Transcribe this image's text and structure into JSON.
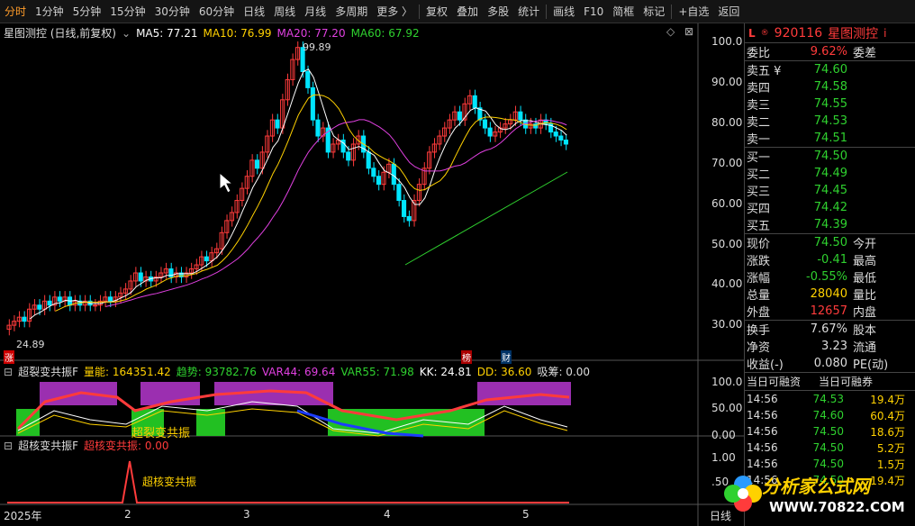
{
  "toolbar": {
    "items": [
      "分时",
      "1分钟",
      "5分钟",
      "15分钟",
      "30分钟",
      "60分钟",
      "日线",
      "周线",
      "月线",
      "多周期",
      "更多 〉",
      "复权",
      "叠加",
      "多股",
      "统计",
      "画线",
      "F10",
      "简框",
      "标记",
      "+自选",
      "返回"
    ]
  },
  "stock": {
    "marker": "L",
    "code": "920116",
    "name": "星图测控",
    "info": "i"
  },
  "main_pane": {
    "title": "星图测控 (日线,前复权)",
    "ma5": "MA5: 77.21",
    "ma10": "MA10: 76.99",
    "ma20": "MA20: 77.20",
    "ma60": "MA60: 67.92",
    "high_label": "99.89",
    "low_label": "24.89",
    "bang_label": "榜",
    "cai_label": "财",
    "zhang_label": "涨",
    "y_ticks": [
      "100.0",
      "90.00",
      "80.00",
      "70.00",
      "60.00",
      "50.00",
      "40.00",
      "30.00"
    ]
  },
  "ind1": {
    "title": "超裂变共振F",
    "liangneng": "量能: 164351.42",
    "qushi": "趋势: 93782.76",
    "var44": "VAR44: 69.64",
    "var55": "VAR55: 71.98",
    "kk": "KK: 24.81",
    "dd": "DD: 36.60",
    "xichou": "吸筹: 0.00",
    "label": "超裂变共振",
    "y_ticks": [
      "100.0",
      "50.00",
      "0.00"
    ]
  },
  "ind2": {
    "title": "超核变共振F",
    "value": "超核变共振: 0.00",
    "label": "超核变共振",
    "y_ticks": [
      "1.00",
      ".50"
    ]
  },
  "x_axis": {
    "labels": [
      "2025年",
      "2",
      "3",
      "4",
      "5"
    ],
    "right_label": "日线"
  },
  "quote": {
    "weibi_label": "委比",
    "weibi": "9.62%",
    "weicha_label": "委差",
    "asks": [
      {
        "label": "卖五 ¥",
        "price": "74.60"
      },
      {
        "label": "卖四",
        "price": "74.58"
      },
      {
        "label": "卖三",
        "price": "74.55"
      },
      {
        "label": "卖二",
        "price": "74.53"
      },
      {
        "label": "卖一",
        "price": "74.51"
      }
    ],
    "bids": [
      {
        "label": "买一",
        "price": "74.50"
      },
      {
        "label": "买二",
        "price": "74.49"
      },
      {
        "label": "买三",
        "price": "74.45"
      },
      {
        "label": "买四",
        "price": "74.42"
      },
      {
        "label": "买五",
        "price": "74.39"
      }
    ],
    "stats": [
      {
        "label": "现价",
        "value": "74.50",
        "label2": "今开",
        "cls": "green"
      },
      {
        "label": "涨跌",
        "value": "-0.41",
        "label2": "最高",
        "cls": "green"
      },
      {
        "label": "涨幅",
        "value": "-0.55%",
        "label2": "最低",
        "cls": "green"
      },
      {
        "label": "总量",
        "value": "28040",
        "label2": "量比",
        "cls": "yellow"
      },
      {
        "label": "外盘",
        "value": "12657",
        "label2": "内盘",
        "cls": "red"
      }
    ],
    "stats2": [
      {
        "label": "换手",
        "value": "7.67%",
        "label2": "股本"
      },
      {
        "label": "净资",
        "value": "3.23",
        "label2": "流通"
      },
      {
        "label": "收益(-)",
        "value": "0.080",
        "label2": "PE(动)"
      }
    ],
    "margin_label1": "当日可融资",
    "margin_label2": "当日可融券",
    "ticks": [
      {
        "time": "14:56",
        "price": "74.53",
        "vol": "19.4万"
      },
      {
        "time": "14:56",
        "price": "74.60",
        "vol": "60.4万"
      },
      {
        "time": "14:56",
        "price": "74.50",
        "vol": "18.6万"
      },
      {
        "time": "14:56",
        "price": "74.50",
        "vol": "5.2万"
      },
      {
        "time": "14:56",
        "price": "74.50",
        "vol": "1.5万"
      },
      {
        "time": "14:56",
        "price": "74.50",
        "vol": "19.4万"
      }
    ]
  },
  "logo": {
    "text": "分析家公式网",
    "url": "WWW.70822.COM"
  },
  "watermark": "分析家公式网 www.70822.com",
  "colors": {
    "up": "#ff3b3b",
    "down": "#00e5ff",
    "ma5": "#ffffff",
    "ma10": "#ffd100",
    "ma20": "#e040e0",
    "ma60": "#2fd12f"
  }
}
